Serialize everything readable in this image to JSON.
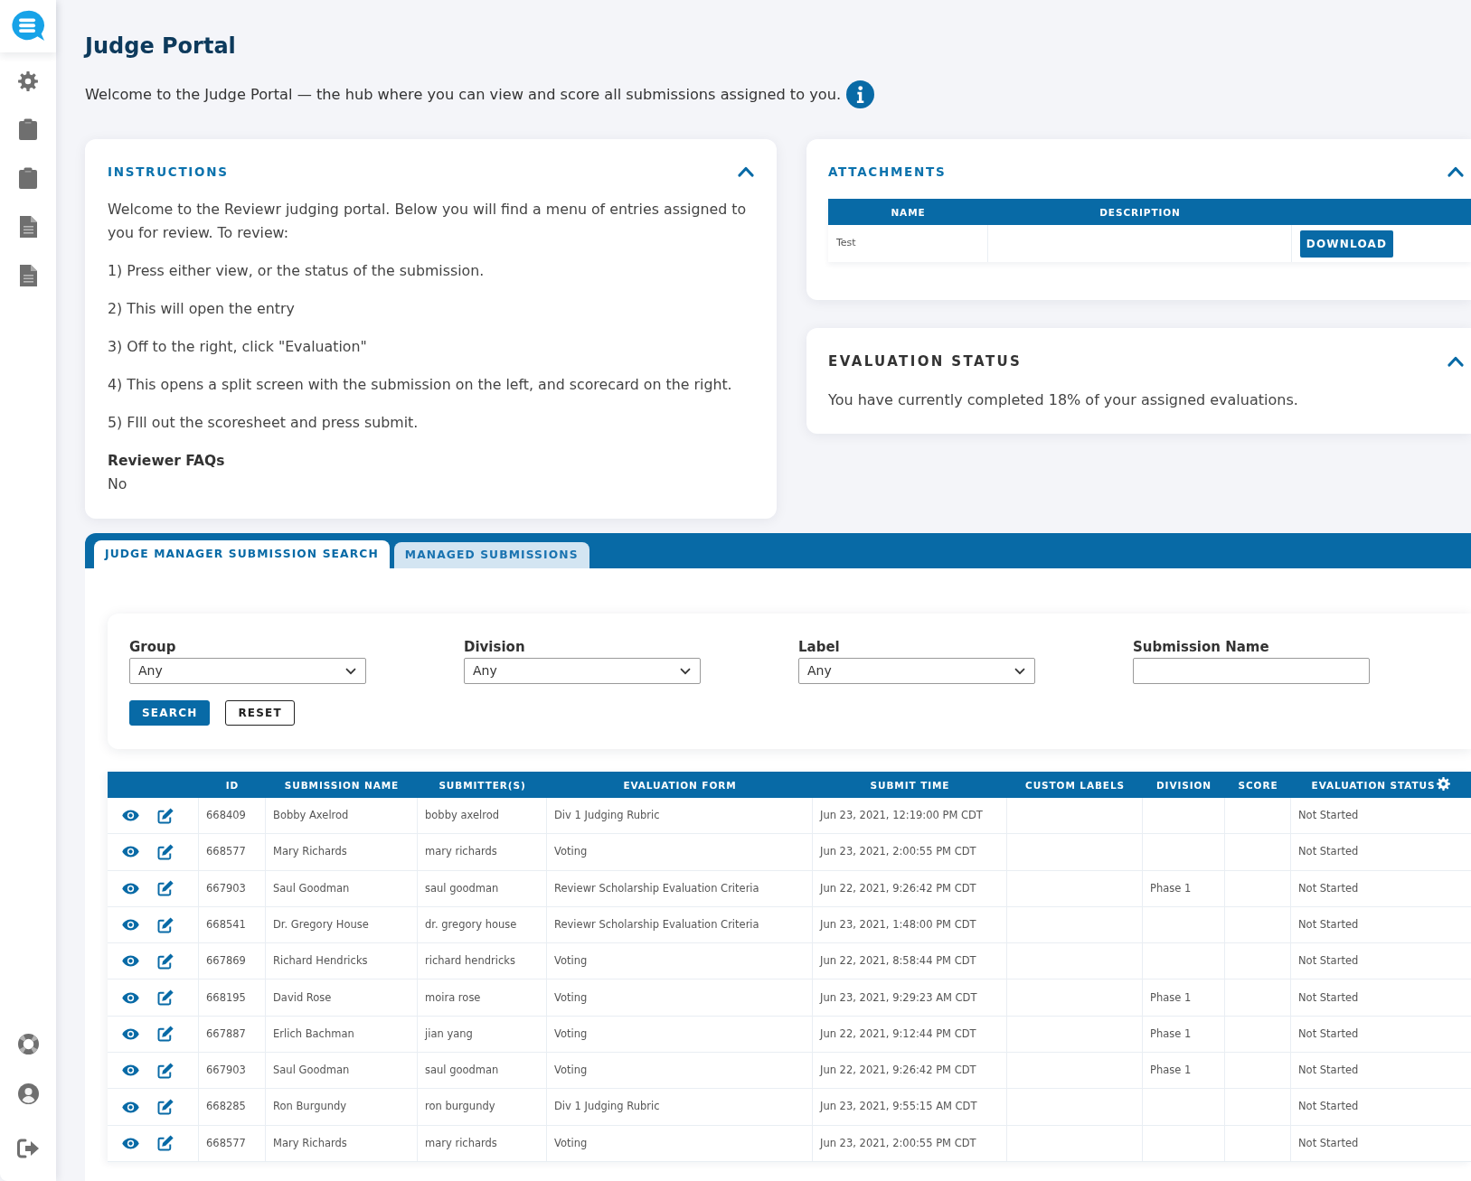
{
  "header": {
    "title": "Judge Portal",
    "intro": "Welcome to the Judge Portal — the hub where you can view and score all submissions assigned to you."
  },
  "instructions": {
    "title": "INSTRUCTIONS",
    "expanded": true,
    "paragraphs": [
      "Welcome to the Reviewr judging portal. Below you will find a menu of entries assigned to you for review. To review:",
      "1) Press either view, or the status of the submission.",
      "2) This will open the entry",
      "3) Off to the right, click \"Evaluation\"",
      "4) This opens a split screen with the submission on the left, and scorecard on the right.",
      "5) FIll out the scoresheet and press submit."
    ],
    "faq": {
      "title": "Reviewer FAQs",
      "answer": "No"
    }
  },
  "attachments": {
    "title": "ATTACHMENTS",
    "expanded": true,
    "columns": [
      "NAME",
      "DESCRIPTION"
    ],
    "rows": [
      {
        "name": "Test",
        "button": "DOWNLOAD"
      }
    ]
  },
  "evaluation_status": {
    "title": "EVALUATION STATUS",
    "expanded": true,
    "text": "You have currently completed 18% of your assigned evaluations."
  },
  "tabs": [
    {
      "label": "JUDGE MANAGER SUBMISSION SEARCH",
      "selected": true
    },
    {
      "label": "MANAGED SUBMISSIONS",
      "selected": false
    }
  ],
  "filters": {
    "fields": [
      {
        "kind": "select",
        "label": "Group",
        "value": "Any"
      },
      {
        "kind": "select",
        "label": "Division",
        "value": "Any"
      },
      {
        "kind": "select",
        "label": "Label",
        "value": "Any"
      },
      {
        "kind": "text",
        "label": "Submission Name"
      }
    ],
    "buttons": [
      {
        "kind": "primary",
        "label": "SEARCH"
      },
      {
        "kind": "outline",
        "label": "RESET"
      }
    ]
  },
  "submissions": {
    "columns": [
      "ID",
      "SUBMISSION NAME",
      "SUBMITTER(S)",
      "EVALUATION FORM",
      "SUBMIT TIME",
      "CUSTOM LABELS",
      "DIVISION",
      "SCORE",
      "EVALUATION STATUS"
    ],
    "rows": [
      {
        "id": "668409",
        "submission_name": "Bobby Axelrod",
        "submitters": "bobby axelrod",
        "evaluation_form": "Div 1 Judging Rubric",
        "submit_time": "Jun 23, 2021, 12:19:00 PM CDT",
        "evaluation_status": "Not Started"
      },
      {
        "id": "668577",
        "submission_name": "Mary Richards",
        "submitters": "mary richards",
        "evaluation_form": "Voting",
        "submit_time": "Jun 23, 2021, 2:00:55 PM CDT",
        "evaluation_status": "Not Started"
      },
      {
        "id": "667903",
        "submission_name": "Saul Goodman",
        "submitters": "saul goodman",
        "evaluation_form": "Reviewr Scholarship Evaluation Criteria",
        "submit_time": "Jun 22, 2021, 9:26:42 PM CDT",
        "division": "Phase 1",
        "evaluation_status": "Not Started"
      },
      {
        "id": "668541",
        "submission_name": "Dr. Gregory House",
        "submitters": "dr. gregory house",
        "evaluation_form": "Reviewr Scholarship Evaluation Criteria",
        "submit_time": "Jun 23, 2021, 1:48:00 PM CDT",
        "evaluation_status": "Not Started"
      },
      {
        "id": "667869",
        "submission_name": "Richard Hendricks",
        "submitters": "richard hendricks",
        "evaluation_form": "Voting",
        "submit_time": "Jun 22, 2021, 8:58:44 PM CDT",
        "evaluation_status": "Not Started"
      },
      {
        "id": "668195",
        "submission_name": "David Rose",
        "submitters": "moira rose",
        "evaluation_form": "Voting",
        "submit_time": "Jun 23, 2021, 9:29:23 AM CDT",
        "division": "Phase 1",
        "evaluation_status": "Not Started"
      },
      {
        "id": "667887",
        "submission_name": "Erlich Bachman",
        "submitters": "jian yang",
        "evaluation_form": "Voting",
        "submit_time": "Jun 22, 2021, 9:12:44 PM CDT",
        "division": "Phase 1",
        "evaluation_status": "Not Started"
      },
      {
        "id": "667903",
        "submission_name": "Saul Goodman",
        "submitters": "saul goodman",
        "evaluation_form": "Voting",
        "submit_time": "Jun 22, 2021, 9:26:42 PM CDT",
        "division": "Phase 1",
        "evaluation_status": "Not Started"
      },
      {
        "id": "668285",
        "submission_name": "Ron Burgundy",
        "submitters": "ron burgundy",
        "evaluation_form": "Div 1 Judging Rubric",
        "submit_time": "Jun 23, 2021, 9:55:15 AM CDT",
        "evaluation_status": "Not Started"
      },
      {
        "id": "668577",
        "submission_name": "Mary Richards",
        "submitters": "mary richards",
        "evaluation_form": "Voting",
        "submit_time": "Jun 23, 2021, 2:00:55 PM CDT",
        "evaluation_status": "Not Started"
      }
    ]
  }
}
